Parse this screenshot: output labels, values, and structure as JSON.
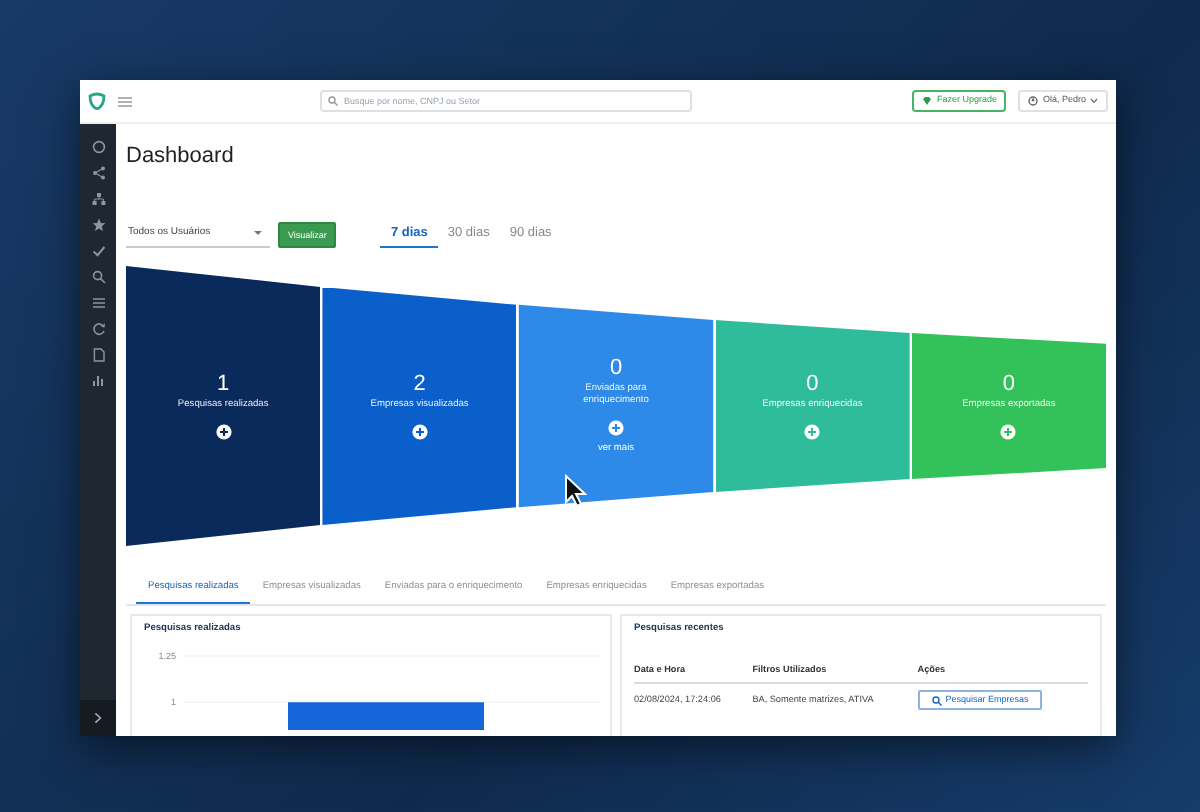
{
  "header": {
    "search": {
      "placeholder": "Busque por nome, CNPJ ou Setor"
    },
    "upgrade_button": "Fazer Upgrade",
    "user_menu": "Olá, Pedro"
  },
  "page_title": "Dashboard",
  "filters": {
    "user_select": "Todos os Usuários",
    "apply_button": "Visualizar"
  },
  "period_tabs": [
    {
      "label": "7 dias",
      "selected": true
    },
    {
      "label": "30 dias",
      "selected": false
    },
    {
      "label": "90 dias",
      "selected": false
    }
  ],
  "summary_cards": [
    {
      "value": "1",
      "label": "Pesquisas realizadas",
      "color": "#0b2a5c"
    },
    {
      "value": "2",
      "label": "Empresas visualizadas",
      "color": "#0a5fca"
    },
    {
      "value": "0",
      "label": "Enviadas para enriquecimento",
      "color": "#2e8ae8",
      "link": "ver mais"
    },
    {
      "value": "0",
      "label": "Empresas enriquecidas",
      "color": "#2fbc9b"
    },
    {
      "value": "0",
      "label": "Empresas exportadas",
      "color": "#33c15a"
    }
  ],
  "detail_tabs": [
    {
      "label": "Pesquisas realizadas",
      "selected": true
    },
    {
      "label": "Empresas visualizadas",
      "selected": false
    },
    {
      "label": "Enviadas para o enriquecimento",
      "selected": false
    },
    {
      "label": "Empresas enriquecidas",
      "selected": false
    },
    {
      "label": "Empresas exportadas",
      "selected": false
    }
  ],
  "chart_panel": {
    "title": "Pesquisas realizadas",
    "chart_data": {
      "type": "bar",
      "values": [
        1
      ],
      "ylim": [
        0.85,
        1.25
      ],
      "yticks": [
        {
          "value": 1.25,
          "label": "1.25"
        },
        1
      ]
    }
  },
  "recent_panel": {
    "title": "Pesquisas recentes",
    "columns": [
      "Data e Hora",
      "Filtros Utilizados",
      "Ações"
    ],
    "rows": [
      {
        "date": "02/08/2024, 17:24:06",
        "filters": "BA, Somente matrizes, ATIVA",
        "action": "Pesquisar Empresas"
      }
    ]
  }
}
